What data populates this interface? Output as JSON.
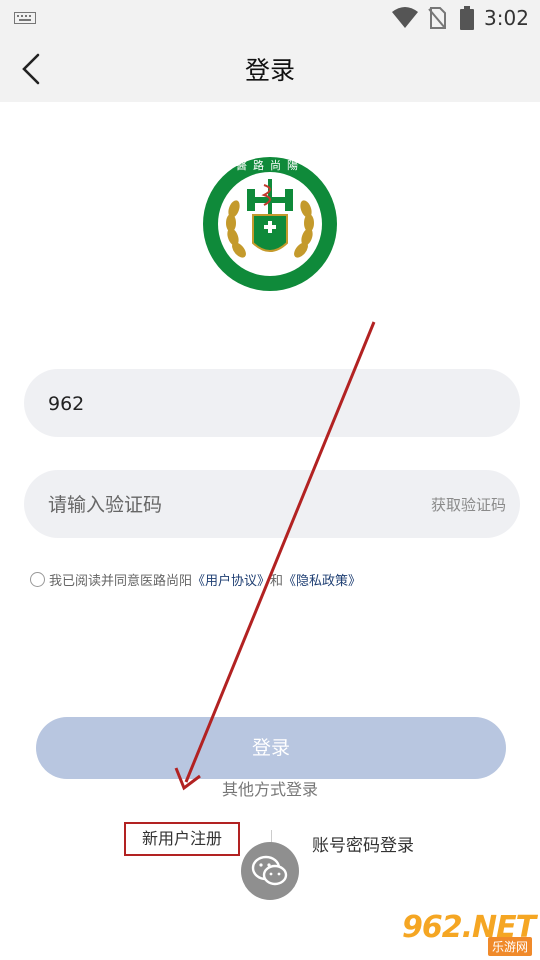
{
  "status_bar": {
    "time": "3:02",
    "icons": [
      "keyboard-icon",
      "wifi-icon",
      "no-sim-icon",
      "battery-icon"
    ]
  },
  "header": {
    "title": "登录",
    "back_icon": "chevron-left-icon"
  },
  "logo": {
    "top_text": "醫路尚陽",
    "ring_text": "SUNSHINE HEALTH GUARD",
    "colors": {
      "green": "#0f8a3a",
      "gold": "#c49a2c"
    }
  },
  "form": {
    "phone_value": "962",
    "code_placeholder": "请输入验证码",
    "get_code_label": "获取验证码"
  },
  "agreement": {
    "prefix": "我已阅读并同意医路尚阳",
    "user_agreement": "《用户协议》",
    "conjunction": "和",
    "privacy_policy": "《隐私政策》"
  },
  "actions": {
    "login_label": "登录",
    "other_methods_label": "其他方式登录",
    "register_label": "新用户注册",
    "password_login_label": "账号密码登录",
    "wechat_icon": "wechat-icon"
  },
  "watermark": {
    "main": "962.NET",
    "sub": "乐游网"
  },
  "colors": {
    "login_button": "#b8c6e0",
    "field_bg": "#eff0f3",
    "link": "#1f3f73",
    "annotation": "#b22222"
  }
}
